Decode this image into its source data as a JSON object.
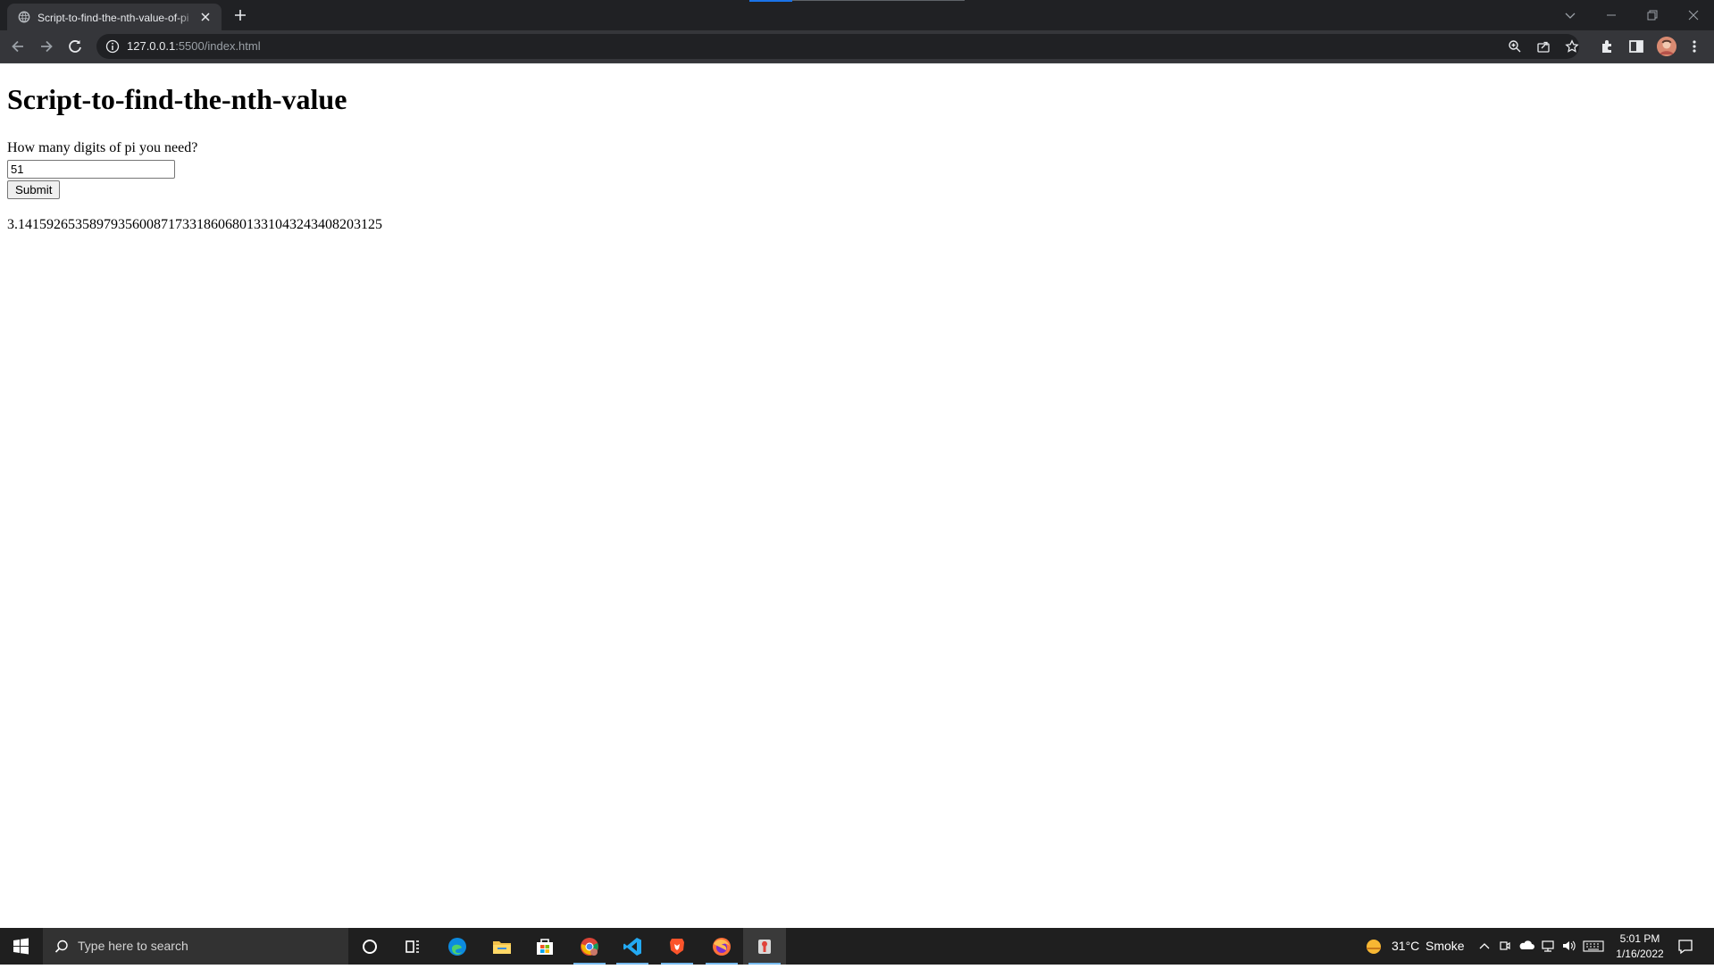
{
  "browser": {
    "tab_title": "Script-to-find-the-nth-value-of-pi",
    "url_host": "127.0.0.1",
    "url_rest": ":5500/index.html"
  },
  "page": {
    "heading": "Script-to-find-the-nth-value",
    "prompt": "How many digits of pi you need?",
    "input_value": "51",
    "submit_label": "Submit",
    "result": "3.141592653589793560087173318606801331043243408203125"
  },
  "taskbar": {
    "search_placeholder": "Type here to search",
    "weather_temp": "31°C",
    "weather_desc": "Smoke",
    "time": "5:01 PM",
    "date": "1/16/2022"
  },
  "colors": {
    "chrome_dark": "#202124",
    "chrome_toolbar": "#35363a",
    "taskbar": "#1f1f1f",
    "accent": "#1a73e8"
  }
}
